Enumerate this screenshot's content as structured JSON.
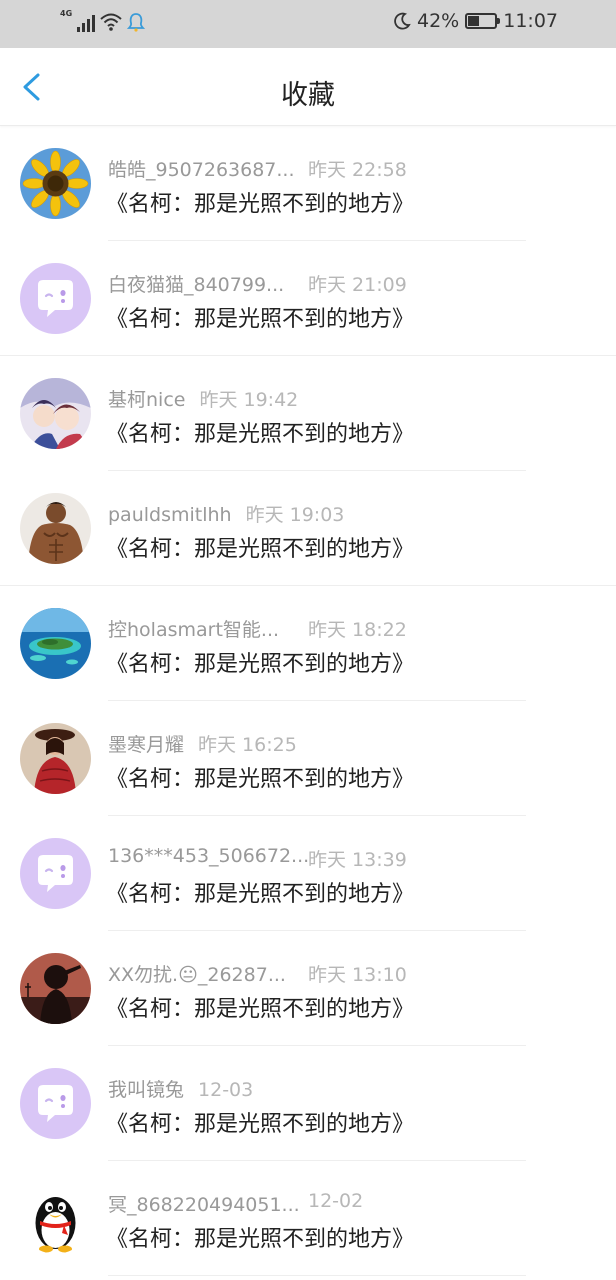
{
  "status_bar": {
    "network": "4G",
    "battery": "42%",
    "battery_level": 0.42,
    "time": "11:07"
  },
  "header": {
    "title": "收藏"
  },
  "items": [
    {
      "name": "皓皓_9507263687...",
      "time": "昨天 22:58",
      "message": "《名柯：那是光照不到的地方》",
      "avatar": "sunflower"
    },
    {
      "name": "白夜猫猫_840799...",
      "time": "昨天 21:09",
      "message": "《名柯：那是光照不到的地方》",
      "avatar": "default-chat"
    },
    {
      "name": "基柯nice",
      "time": "昨天 19:42",
      "message": "《名柯：那是光照不到的地方》",
      "avatar": "anime"
    },
    {
      "name": "pauldsmitlhh",
      "time": "昨天 19:03",
      "message": "《名柯：那是光照不到的地方》",
      "avatar": "muscle-man"
    },
    {
      "name": "控holasmart智能...",
      "time": "昨天 18:22",
      "message": "《名柯：那是光照不到的地方》",
      "avatar": "island"
    },
    {
      "name": "墨寒月耀",
      "time": "昨天 16:25",
      "message": "《名柯：那是光照不到的地方》",
      "avatar": "woman-red"
    },
    {
      "name": "136***453_506672...",
      "time": "昨天 13:39",
      "message": "《名柯：那是光照不到的地方》",
      "avatar": "default-chat"
    },
    {
      "name": "XX勿扰.😐_26287...",
      "time": "昨天 13:10",
      "message": "《名柯：那是光照不到的地方》",
      "avatar": "silhouette"
    },
    {
      "name": "我叫镜兔",
      "time": "12-03",
      "message": "《名柯：那是光照不到的地方》",
      "avatar": "default-chat"
    },
    {
      "name": "冥_868220494051...",
      "time": "12-02",
      "message": "《名柯：那是光照不到的地方》",
      "avatar": "penguin"
    }
  ]
}
